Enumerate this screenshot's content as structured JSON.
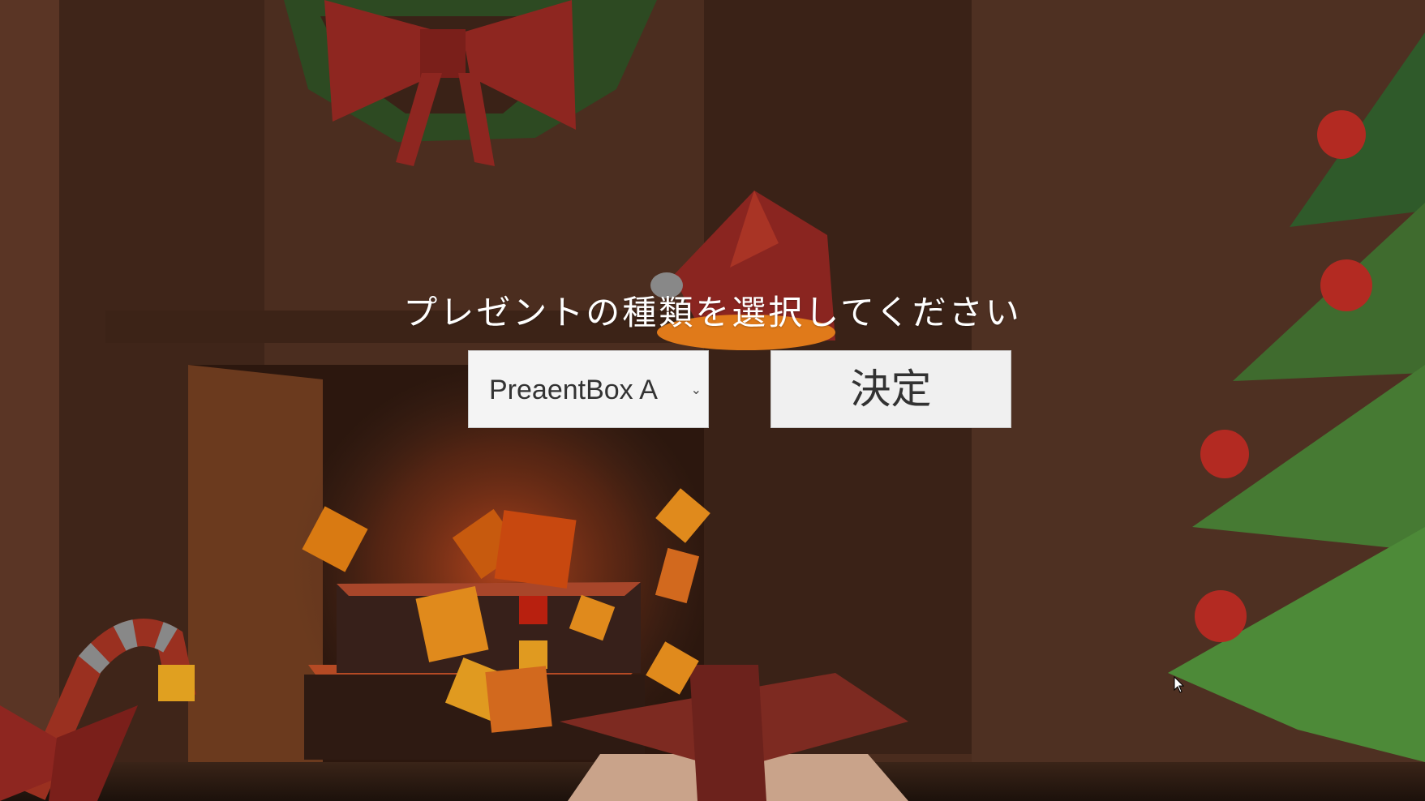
{
  "prompt": {
    "text": "プレゼントの種類を選択してください"
  },
  "dropdown": {
    "selected_value": "PreaentBox A",
    "arrow_icon": "chevron-down-icon"
  },
  "confirm_button": {
    "label": "決定"
  },
  "colors": {
    "wall": "#4a2c1e",
    "ribbon_red": "#9a2b20",
    "tree_green": "#3f6b2e",
    "fire_orange": "#d2691e",
    "ui_panel": "#f4f4f4",
    "ui_text": "#333333",
    "prompt_text": "#ffffff"
  }
}
